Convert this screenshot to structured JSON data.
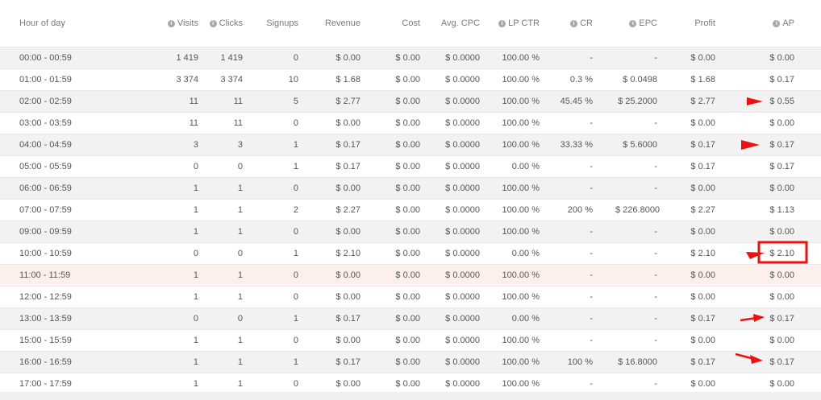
{
  "columns": [
    {
      "key": "hour",
      "label": "Hour of day",
      "info": false
    },
    {
      "key": "visits",
      "label": "Visits",
      "info": true
    },
    {
      "key": "clicks",
      "label": "Clicks",
      "info": true
    },
    {
      "key": "signups",
      "label": "Signups",
      "info": false
    },
    {
      "key": "revenue",
      "label": "Revenue",
      "info": false
    },
    {
      "key": "cost",
      "label": "Cost",
      "info": false
    },
    {
      "key": "avg_cpc",
      "label": "Avg. CPC",
      "info": false
    },
    {
      "key": "lp_ctr",
      "label": "LP CTR",
      "info": true
    },
    {
      "key": "cr",
      "label": "CR",
      "info": true
    },
    {
      "key": "epc",
      "label": "EPC",
      "info": true
    },
    {
      "key": "profit",
      "label": "Profit",
      "info": false
    },
    {
      "key": "ap",
      "label": "AP",
      "info": true
    }
  ],
  "info_icon_glyph": "i",
  "rows": [
    {
      "hour": "00:00 - 00:59",
      "visits": "1 419",
      "clicks": "1 419",
      "signups": "0",
      "revenue": "$ 0.00",
      "cost": "$ 0.00",
      "avg_cpc": "$ 0.0000",
      "lp_ctr": "100.00 %",
      "cr": "-",
      "epc": "-",
      "profit": "$ 0.00",
      "ap": "$ 0.00"
    },
    {
      "hour": "01:00 - 01:59",
      "visits": "3 374",
      "clicks": "3 374",
      "signups": "10",
      "revenue": "$ 1.68",
      "cost": "$ 0.00",
      "avg_cpc": "$ 0.0000",
      "lp_ctr": "100.00 %",
      "cr": "0.3 %",
      "epc": "$ 0.0498",
      "profit": "$ 1.68",
      "ap": "$ 0.17"
    },
    {
      "hour": "02:00 - 02:59",
      "visits": "11",
      "clicks": "11",
      "signups": "5",
      "revenue": "$ 2.77",
      "cost": "$ 0.00",
      "avg_cpc": "$ 0.0000",
      "lp_ctr": "100.00 %",
      "cr": "45.45 %",
      "epc": "$ 25.2000",
      "profit": "$ 2.77",
      "ap": "$ 0.55"
    },
    {
      "hour": "03:00 - 03:59",
      "visits": "11",
      "clicks": "11",
      "signups": "0",
      "revenue": "$ 0.00",
      "cost": "$ 0.00",
      "avg_cpc": "$ 0.0000",
      "lp_ctr": "100.00 %",
      "cr": "-",
      "epc": "-",
      "profit": "$ 0.00",
      "ap": "$ 0.00"
    },
    {
      "hour": "04:00 - 04:59",
      "visits": "3",
      "clicks": "3",
      "signups": "1",
      "revenue": "$ 0.17",
      "cost": "$ 0.00",
      "avg_cpc": "$ 0.0000",
      "lp_ctr": "100.00 %",
      "cr": "33.33 %",
      "epc": "$ 5.6000",
      "profit": "$ 0.17",
      "ap": "$ 0.17"
    },
    {
      "hour": "05:00 - 05:59",
      "visits": "0",
      "clicks": "0",
      "signups": "1",
      "revenue": "$ 0.17",
      "cost": "$ 0.00",
      "avg_cpc": "$ 0.0000",
      "lp_ctr": "0.00 %",
      "cr": "-",
      "epc": "-",
      "profit": "$ 0.17",
      "ap": "$ 0.17"
    },
    {
      "hour": "06:00 - 06:59",
      "visits": "1",
      "clicks": "1",
      "signups": "0",
      "revenue": "$ 0.00",
      "cost": "$ 0.00",
      "avg_cpc": "$ 0.0000",
      "lp_ctr": "100.00 %",
      "cr": "-",
      "epc": "-",
      "profit": "$ 0.00",
      "ap": "$ 0.00"
    },
    {
      "hour": "07:00 - 07:59",
      "visits": "1",
      "clicks": "1",
      "signups": "2",
      "revenue": "$ 2.27",
      "cost": "$ 0.00",
      "avg_cpc": "$ 0.0000",
      "lp_ctr": "100.00 %",
      "cr": "200 %",
      "epc": "$ 226.8000",
      "profit": "$ 2.27",
      "ap": "$ 1.13"
    },
    {
      "hour": "09:00 - 09:59",
      "visits": "1",
      "clicks": "1",
      "signups": "0",
      "revenue": "$ 0.00",
      "cost": "$ 0.00",
      "avg_cpc": "$ 0.0000",
      "lp_ctr": "100.00 %",
      "cr": "-",
      "epc": "-",
      "profit": "$ 0.00",
      "ap": "$ 0.00"
    },
    {
      "hour": "10:00 - 10:59",
      "visits": "0",
      "clicks": "0",
      "signups": "1",
      "revenue": "$ 2.10",
      "cost": "$ 0.00",
      "avg_cpc": "$ 0.0000",
      "lp_ctr": "0.00 %",
      "cr": "-",
      "epc": "-",
      "profit": "$ 2.10",
      "ap": "$ 2.10"
    },
    {
      "hour": "11:00 - 11:59",
      "visits": "1",
      "clicks": "1",
      "signups": "0",
      "revenue": "$ 0.00",
      "cost": "$ 0.00",
      "avg_cpc": "$ 0.0000",
      "lp_ctr": "100.00 %",
      "cr": "-",
      "epc": "-",
      "profit": "$ 0.00",
      "ap": "$ 0.00"
    },
    {
      "hour": "12:00 - 12:59",
      "visits": "1",
      "clicks": "1",
      "signups": "0",
      "revenue": "$ 0.00",
      "cost": "$ 0.00",
      "avg_cpc": "$ 0.0000",
      "lp_ctr": "100.00 %",
      "cr": "-",
      "epc": "-",
      "profit": "$ 0.00",
      "ap": "$ 0.00"
    },
    {
      "hour": "13:00 - 13:59",
      "visits": "0",
      "clicks": "0",
      "signups": "1",
      "revenue": "$ 0.17",
      "cost": "$ 0.00",
      "avg_cpc": "$ 0.0000",
      "lp_ctr": "0.00 %",
      "cr": "-",
      "epc": "-",
      "profit": "$ 0.17",
      "ap": "$ 0.17"
    },
    {
      "hour": "15:00 - 15:59",
      "visits": "1",
      "clicks": "1",
      "signups": "0",
      "revenue": "$ 0.00",
      "cost": "$ 0.00",
      "avg_cpc": "$ 0.0000",
      "lp_ctr": "100.00 %",
      "cr": "-",
      "epc": "-",
      "profit": "$ 0.00",
      "ap": "$ 0.00"
    },
    {
      "hour": "16:00 - 16:59",
      "visits": "1",
      "clicks": "1",
      "signups": "1",
      "revenue": "$ 0.17",
      "cost": "$ 0.00",
      "avg_cpc": "$ 0.0000",
      "lp_ctr": "100.00 %",
      "cr": "100 %",
      "epc": "$ 16.8000",
      "profit": "$ 0.17",
      "ap": "$ 0.17"
    },
    {
      "hour": "17:00 - 17:59",
      "visits": "1",
      "clicks": "1",
      "signups": "0",
      "revenue": "$ 0.00",
      "cost": "$ 0.00",
      "avg_cpc": "$ 0.0000",
      "lp_ctr": "100.00 %",
      "cr": "-",
      "epc": "-",
      "profit": "$ 0.00",
      "ap": "$ 0.00"
    }
  ],
  "highlighted_row": "11:00 - 11:59",
  "annotation_color": "#ee1111",
  "row_stripe_color": "#f2f2f2",
  "highlight_row_color": "#fdf0ec"
}
